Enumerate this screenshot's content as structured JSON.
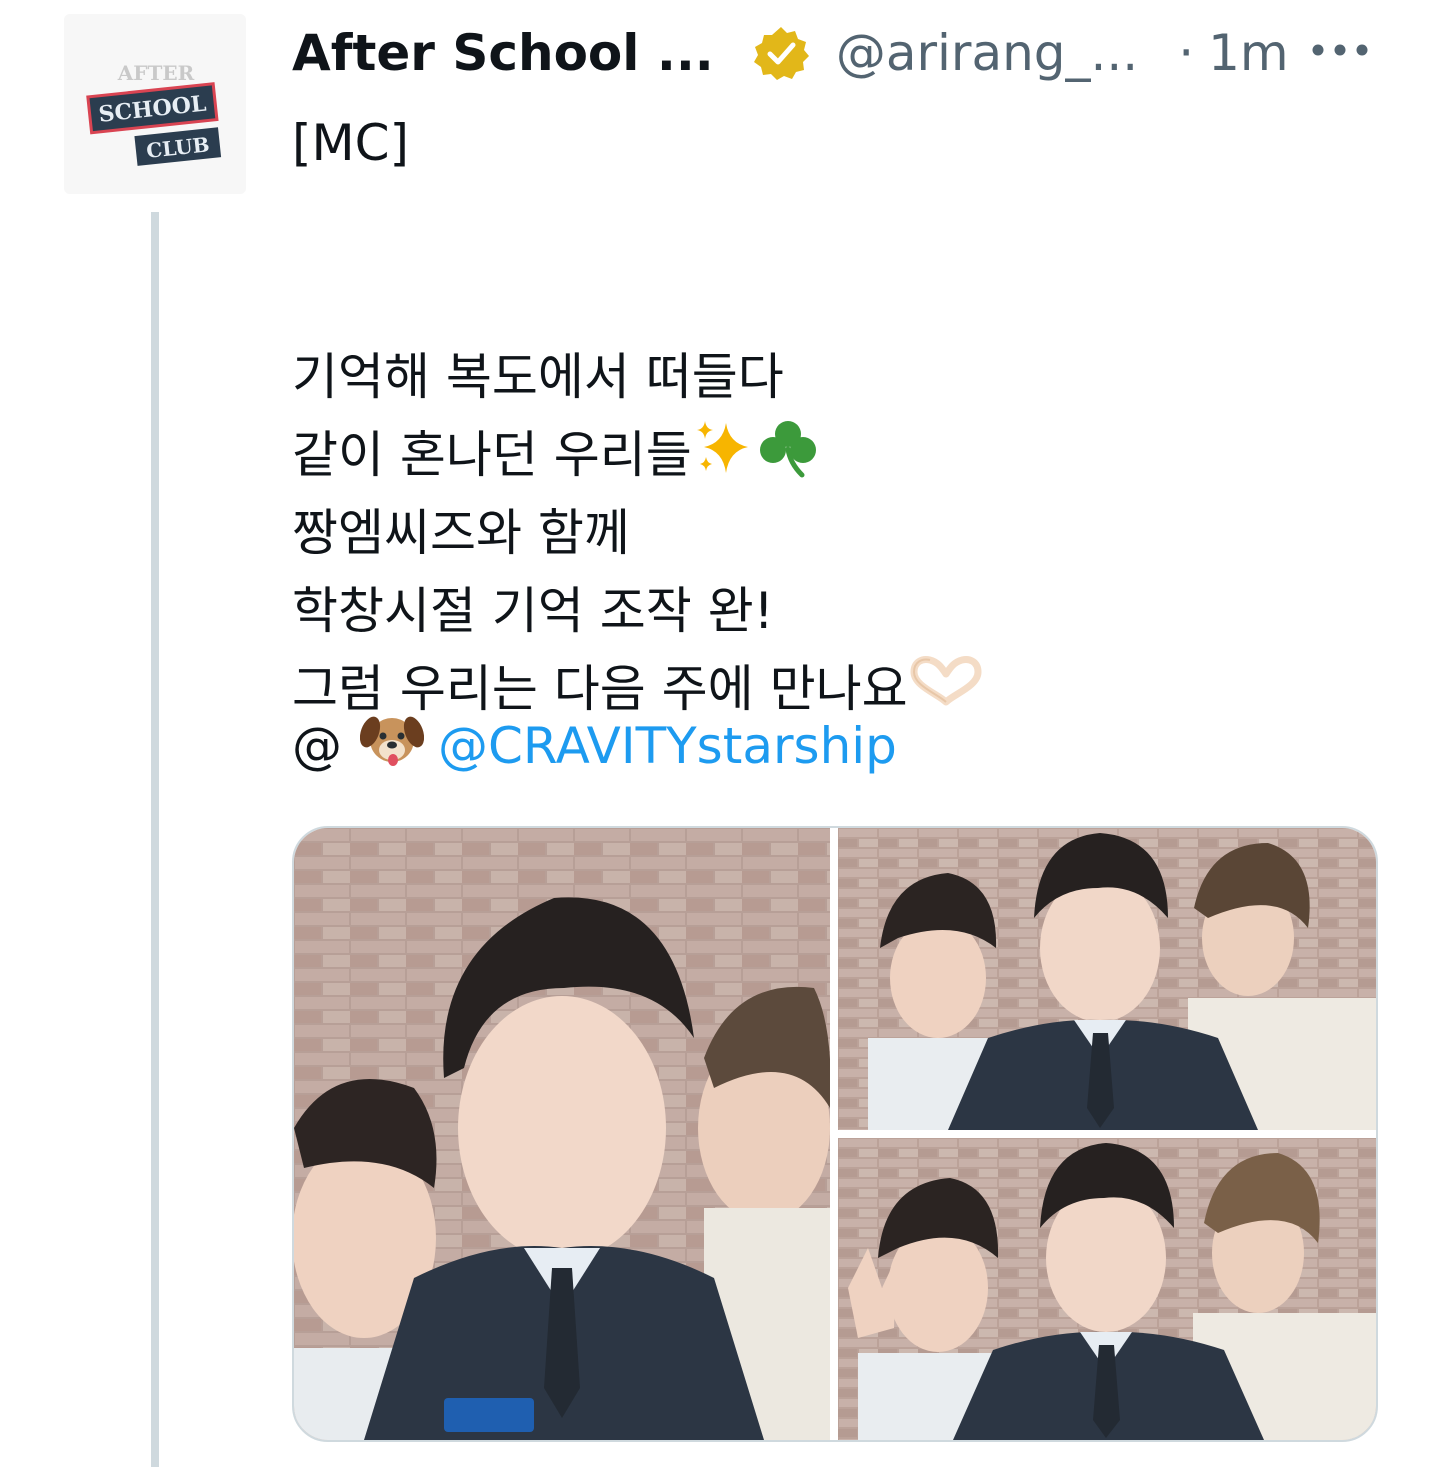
{
  "tweet": {
    "author": {
      "display_name": "After School ...",
      "handle": "@arirang_...",
      "verified_badge": "gold-check-icon",
      "avatar_lines": [
        "AFTER",
        "SCHOOL",
        "CLUB"
      ]
    },
    "separator": "·",
    "timestamp": "1m",
    "more_icon": "ellipsis-icon",
    "text_lines": [
      "[MC]",
      "",
      "기억해 복도에서 떠들다",
      "같이 혼나던 우리들",
      "짱엠씨즈와 함께",
      "학창시절 기억 조작 완!",
      "그럼 우리는 다음 주에 만나요"
    ],
    "emojis": {
      "line4": [
        "sparkles-icon",
        "shamrock-icon"
      ],
      "line7": [
        "heart-hands-icon"
      ]
    },
    "mention_prefix": "@",
    "mention_emoji": "dog-face-icon",
    "mention": "@CRAVITYstarship",
    "media": [
      {
        "name": "photo-1"
      },
      {
        "name": "photo-2"
      },
      {
        "name": "photo-3"
      }
    ],
    "colors": {
      "link": "#1d9bf0",
      "secondary_text": "#536471",
      "verified_gold": "#e2b719",
      "thread_line": "#cfd9de"
    }
  }
}
